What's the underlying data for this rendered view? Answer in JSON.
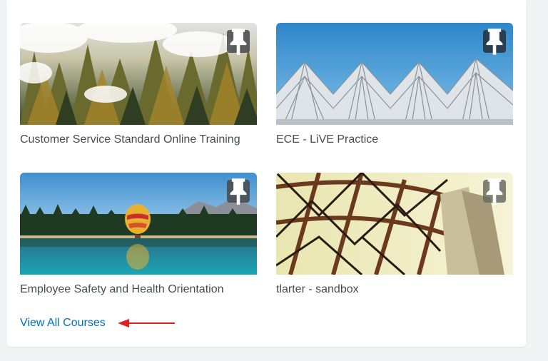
{
  "courses": [
    {
      "title": "Customer Service Standard Online Training",
      "image": "foggy-forest",
      "pinned": true
    },
    {
      "title": "ECE - LiVE Practice",
      "image": "steel-canopy",
      "pinned": true
    },
    {
      "title": "Employee Safety and Health Orientation",
      "image": "balloon-lake",
      "pinned": true
    },
    {
      "title": "tlarter - sandbox",
      "image": "bridge-girders",
      "pinned": true
    }
  ],
  "view_all_label": "View All Courses",
  "colors": {
    "link": "#006fbf",
    "title_text": "#494c4e",
    "pin_bg": "#46484a",
    "annotation_arrow": "#e02020"
  },
  "icons": {
    "pin": "pin-icon"
  }
}
